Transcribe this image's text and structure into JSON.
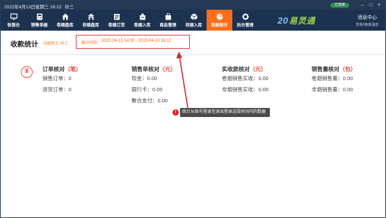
{
  "titlebar": {
    "datetime": "2022年4月13日星期三 16:12",
    "user": "孙三",
    "network_badge": "已连接",
    "minimize": "–",
    "maximize": "□",
    "close": "×"
  },
  "nav": {
    "items": [
      {
        "label": "收银台",
        "icon": "monitor-icon"
      },
      {
        "label": "销售单据",
        "icon": "calculator-icon"
      },
      {
        "label": "卷烟盘库",
        "icon": "house-icon"
      },
      {
        "label": "非烟盘库",
        "icon": "store-icon"
      },
      {
        "label": "卷烟订货",
        "icon": "order-icon"
      },
      {
        "label": "卷烟入库",
        "icon": "box-in-icon"
      },
      {
        "label": "商品管理",
        "icon": "bag-icon"
      },
      {
        "label": "非烟入库",
        "icon": "box-icon"
      },
      {
        "label": "收款统计",
        "icon": "pie-chart-icon",
        "active": true
      },
      {
        "label": "后台管理",
        "icon": "gear-icon"
      }
    ],
    "logo_text": "易灵通",
    "logo_number": "20",
    "message_center": "消息中心",
    "message_sub": "您有0条新消息"
  },
  "header": {
    "title": "收款统计",
    "cashier_label": "当前员工：",
    "cashier_name": "孙三",
    "time_label": "统计时间：",
    "time_value": "2022-04-13 14:30 - 2022-04-13 16:12"
  },
  "stats": {
    "orders": {
      "title": "订单核对",
      "unit": "（笔）",
      "rows": [
        "销售订单：0",
        "退货订单：0"
      ]
    },
    "sales_amount": {
      "title": "销售单核对",
      "unit": "（元）",
      "rows": [
        "现金：0.00",
        "银行卡：0.00",
        "聚合支付：0.00"
      ]
    },
    "received": {
      "title": "实收款核对",
      "unit": "（元）",
      "rows": [
        "卷烟销售实收：0.00",
        "非烟销售实收：0.00"
      ]
    },
    "volume": {
      "title": "销售量核对",
      "unit": "（包）",
      "rows": [
        "卷烟销售量：0.00",
        "非烟销售量：0.00"
      ]
    }
  },
  "tooltip": {
    "marker": "!",
    "text": "统计从账号登录至退出登录这段时间内的数据"
  },
  "colors": {
    "titlebar": "#233954",
    "navbar": "#1c3250",
    "active_tab": "#ff6f1a",
    "accent_orange": "#ff6600",
    "unit_red": "#e84c3d",
    "highlight_red": "#e23b3b"
  }
}
